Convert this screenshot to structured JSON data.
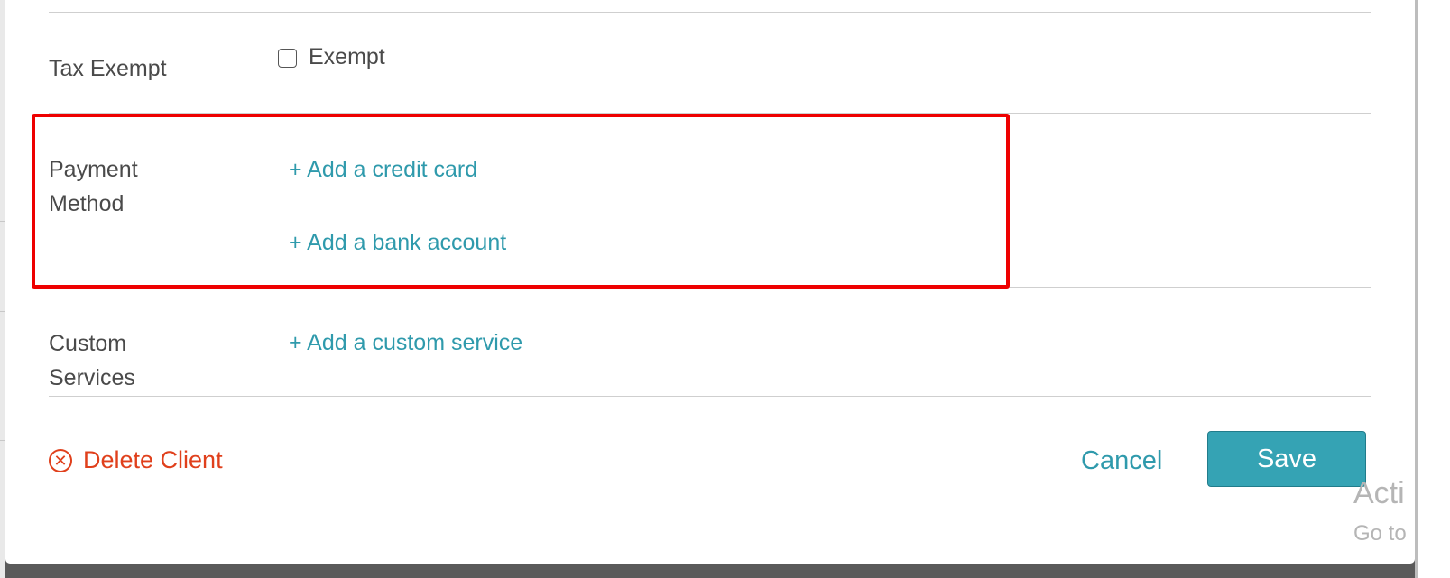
{
  "form": {
    "tax_exempt": {
      "label": "Tax Exempt",
      "checkbox_label": "Exempt",
      "checked": false
    },
    "payment_method": {
      "label_line1": "Payment",
      "label_line2": "Method",
      "add_credit_card": "+ Add a credit card",
      "add_bank_account": "+ Add a bank account"
    },
    "custom_services": {
      "label_line1": "Custom",
      "label_line2": "Services",
      "add_custom_service": "+ Add a custom service"
    }
  },
  "footer": {
    "delete_client_label": "Delete Client",
    "cancel_label": "Cancel",
    "save_label": "Save"
  },
  "watermark": {
    "line1": "Acti",
    "line2": "Go to"
  },
  "colors": {
    "link": "#2f9aac",
    "danger": "#e0401c",
    "primary_button": "#35a3b4",
    "highlight": "#ee0000"
  }
}
